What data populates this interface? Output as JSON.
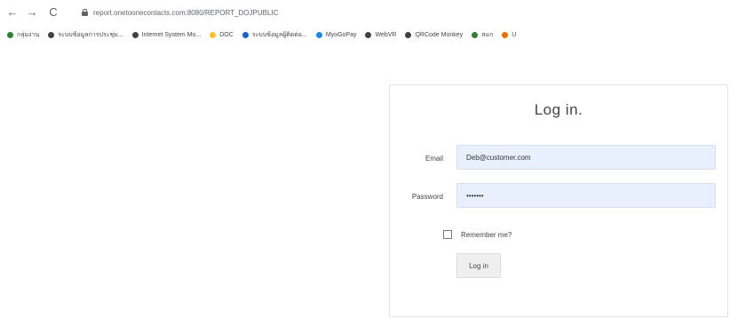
{
  "browser": {
    "url": "report.onetoonecontacts.com:8080/REPORT_DOJPUBLIC",
    "nav": {
      "back": "←",
      "forward": "→",
      "reload": "C"
    },
    "bookmarks": [
      {
        "label": "กลุ่มงาน",
        "color": "#2e7d32"
      },
      {
        "label": "ระบบข้อมูลการประชุม...",
        "color": "#424242"
      },
      {
        "label": "Internet System Mo...",
        "color": "#424242"
      },
      {
        "label": "DOC",
        "color": "#fbc02d"
      },
      {
        "label": "ระบบข้อมูลผู้ติดต่อ...",
        "color": "#1565c0"
      },
      {
        "label": "MyoGoPay",
        "color": "#1e88e5"
      },
      {
        "label": "WebVR",
        "color": "#424242"
      },
      {
        "label": "QRCode Monkey",
        "color": "#424242"
      },
      {
        "label": "สแก",
        "color": "#2e7d32"
      },
      {
        "label": "U",
        "color": "#ef6c00"
      }
    ]
  },
  "login": {
    "title": "Log in.",
    "email_label": "Email",
    "email_value": "Deb@customer.com",
    "password_label": "Password",
    "password_value": "•••••••",
    "remember_label": "Remember me?",
    "submit_label": "Log in"
  }
}
